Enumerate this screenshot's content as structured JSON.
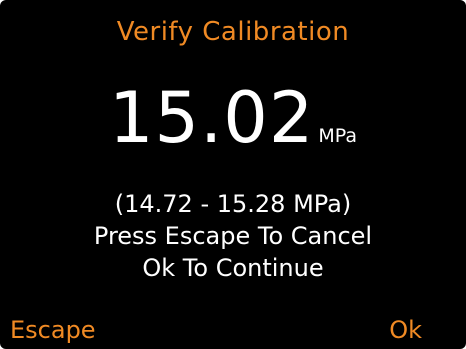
{
  "screen": {
    "title": "Verify Calibration",
    "reading": {
      "value": "15.02",
      "unit": "MPa"
    },
    "range_text": "(14.72 - 15.28 MPa)",
    "instruction_line1": "Press Escape To Cancel",
    "instruction_line2": "Ok To Continue"
  },
  "softkeys": {
    "left_label": "Escape",
    "right_label": "Ok"
  },
  "colors": {
    "background": "#000000",
    "accent": "#f08a24",
    "text": "#ffffff"
  }
}
